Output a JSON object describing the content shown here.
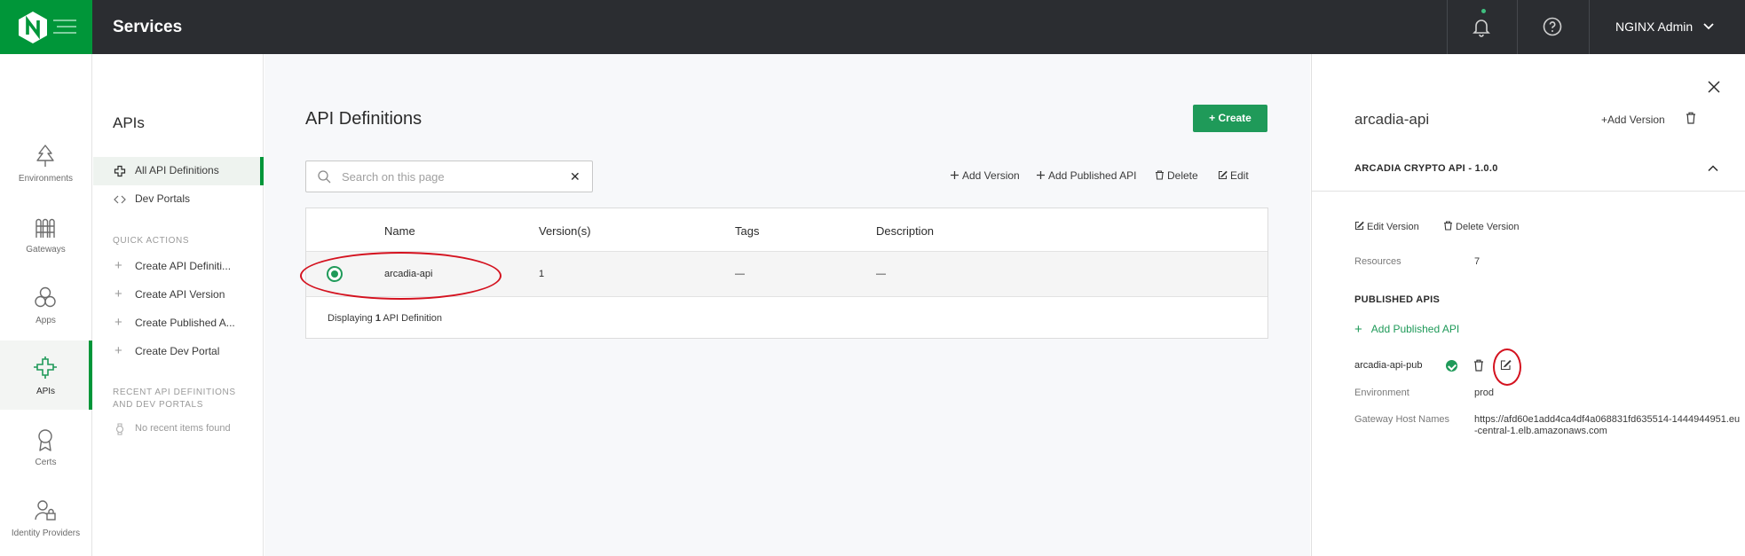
{
  "topbar": {
    "title": "Services",
    "user_name": "NGINX Admin"
  },
  "rail": {
    "items": [
      {
        "label": "Environments",
        "icon": "tree-icon"
      },
      {
        "label": "Gateways",
        "icon": "gateway-icon"
      },
      {
        "label": "Apps",
        "icon": "apps-icon"
      },
      {
        "label": "APIs",
        "icon": "api-icon",
        "active": true
      },
      {
        "label": "Certs",
        "icon": "certificate-icon"
      },
      {
        "label": "Identity Providers",
        "icon": "identity-icon"
      }
    ]
  },
  "subnav": {
    "title": "APIs",
    "items": [
      {
        "label": "All API Definitions",
        "active": true
      },
      {
        "label": "Dev Portals"
      }
    ],
    "quick_actions_heading": "QUICK ACTIONS",
    "quick_actions": [
      {
        "label": "Create API Definiti..."
      },
      {
        "label": "Create API Version"
      },
      {
        "label": "Create Published A..."
      },
      {
        "label": "Create Dev Portal"
      }
    ],
    "recent_heading_line1": "RECENT API DEFINITIONS",
    "recent_heading_line2": "AND DEV PORTALS",
    "recent_empty": "No recent items found"
  },
  "main": {
    "title": "API Definitions",
    "create_label": "Create",
    "search": {
      "placeholder": "Search on this page",
      "value": ""
    },
    "actions": {
      "add_version": "Add Version",
      "add_published_api": "Add Published API",
      "delete": "Delete",
      "edit": "Edit"
    },
    "table": {
      "columns": [
        "Name",
        "Version(s)",
        "Tags",
        "Description"
      ],
      "rows": [
        {
          "name": "arcadia-api",
          "versions": "1",
          "tags": "—",
          "description": "—",
          "selected": true
        }
      ],
      "footer_prefix": "Displaying ",
      "footer_count": "1",
      "footer_suffix": " API Definition"
    }
  },
  "panel": {
    "title": "arcadia-api",
    "add_version": "Add Version",
    "section_title": "ARCADIA CRYPTO API - 1.0.0",
    "edit_version": "Edit Version",
    "delete_version": "Delete Version",
    "resources_label": "Resources",
    "resources_value": "7",
    "published_heading": "PUBLISHED APIS",
    "add_published": "Add Published API",
    "published": {
      "name": "arcadia-api-pub",
      "environment_label": "Environment",
      "environment_value": "prod",
      "gateway_label": "Gateway Host Names",
      "gateway_value": "https://afd60e1add4ca4df4a068831fd635514-1444944951.eu-central-1.elb.amazonaws.com"
    }
  },
  "colors": {
    "brand_green": "#009639",
    "button_green": "#1f9a59",
    "topbar": "#2b2d31",
    "annotation_red": "#d4121f"
  }
}
